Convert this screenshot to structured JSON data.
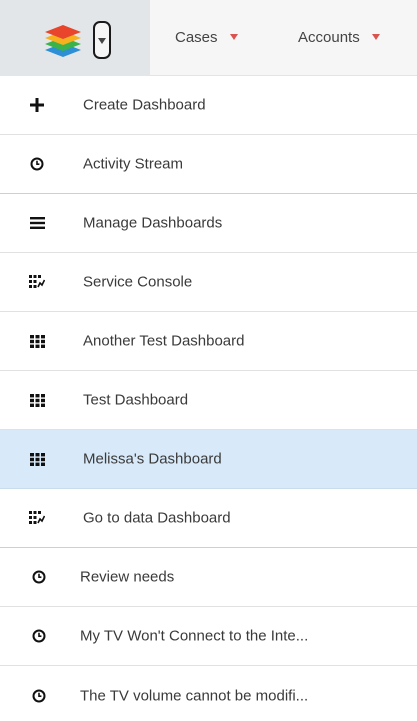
{
  "nav": {
    "tabs": [
      {
        "label": "Cases"
      },
      {
        "label": "Accounts"
      }
    ]
  },
  "menu": {
    "items": [
      {
        "label": "Create Dashboard",
        "icon": "plus-icon"
      },
      {
        "label": "Activity Stream",
        "icon": "clock-icon"
      },
      {
        "label": "Manage Dashboards",
        "icon": "list-icon"
      },
      {
        "label": "Service Console",
        "icon": "grid-chart-icon"
      },
      {
        "label": "Another Test Dashboard",
        "icon": "grid-icon"
      },
      {
        "label": "Test Dashboard",
        "icon": "grid-icon"
      },
      {
        "label": "Melissa's Dashboard",
        "icon": "grid-icon",
        "active": true
      },
      {
        "label": "Go to data Dashboard",
        "icon": "grid-chart-icon"
      },
      {
        "label": "Review needs",
        "icon": "clock-icon"
      },
      {
        "label": "My TV Won't Connect to the Inte...",
        "icon": "clock-icon"
      },
      {
        "label": "The TV volume cannot be modifi...",
        "icon": "clock-icon"
      }
    ]
  },
  "colors": {
    "active_row": "#d8eaf9",
    "caret": "#d9534f",
    "logo_layers": [
      "#e8452c",
      "#f7b11e",
      "#3cb34a",
      "#2d8fd5"
    ]
  }
}
